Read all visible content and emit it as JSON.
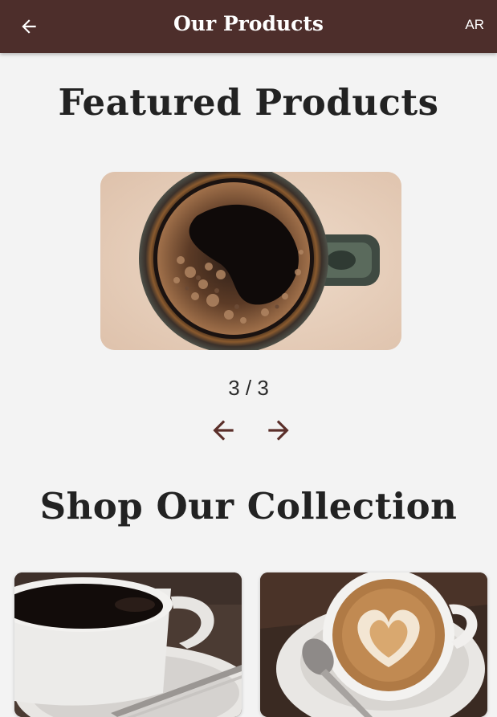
{
  "appbar": {
    "title": "Our Products",
    "language_label": "AR",
    "back_icon": "arrow-left-icon",
    "background_color": "#4d2e2b"
  },
  "featured": {
    "title": "Featured Products",
    "carousel": {
      "pager_text": "3 / 3",
      "current_image": "coffee-mug-top-view-image",
      "prev_icon": "arrow-left-icon",
      "next_icon": "arrow-right-icon"
    }
  },
  "collection": {
    "title": "Shop Our Collection",
    "products": [
      {
        "image": "black-coffee-cup-image"
      },
      {
        "image": "latte-art-heart-cup-image"
      }
    ]
  },
  "colors": {
    "accent": "#5b2f2a",
    "page_background": "#f3f3f3"
  }
}
